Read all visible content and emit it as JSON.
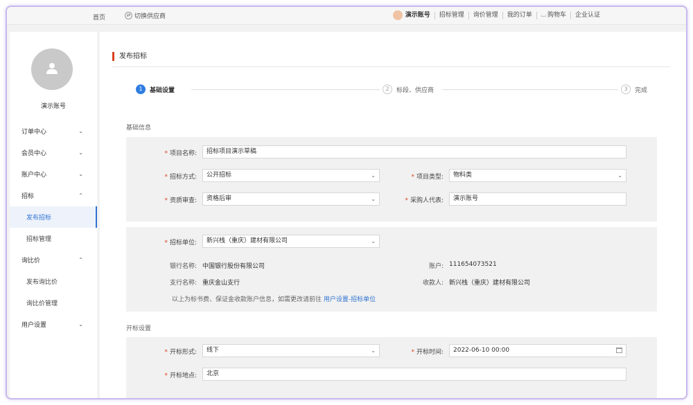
{
  "topbar": {
    "home": "首页",
    "switch_supplier": "切换供应商",
    "user": "演示账号",
    "links": [
      "招标管理",
      "询价管理",
      "我的订单",
      "购物车",
      "企业认证"
    ]
  },
  "sidebar": {
    "username": "演示账号",
    "items": [
      {
        "label": "订单中心",
        "chevron": "⌄"
      },
      {
        "label": "会员中心",
        "chevron": "⌄"
      },
      {
        "label": "账户中心",
        "chevron": "⌄"
      },
      {
        "label": "招标",
        "chevron": "⌃"
      },
      {
        "label": "发布招标"
      },
      {
        "label": "招标管理"
      },
      {
        "label": "询比价",
        "chevron": "⌃"
      },
      {
        "label": "发布询比价"
      },
      {
        "label": "询比价管理"
      },
      {
        "label": "用户设置",
        "chevron": "⌄"
      }
    ]
  },
  "main": {
    "page_title": "发布招标",
    "steps": [
      {
        "num": "1",
        "label": "基础设置"
      },
      {
        "num": "2",
        "label": "标段、供应商"
      },
      {
        "num": "3",
        "label": "完成"
      }
    ],
    "basic_title": "基础信息",
    "form": {
      "project_name_label": "项目名称:",
      "project_name_value": "招标项目演示草稿",
      "bid_method_label": "招标方式:",
      "bid_method_value": "公开招标",
      "project_type_label": "项目类型:",
      "project_type_value": "物料类",
      "qual_review_label": "资质审查:",
      "qual_review_value": "资格后审",
      "buyer_rep_label": "采购人代表:",
      "buyer_rep_value": "演示账号"
    },
    "unit": {
      "bid_unit_label": "招标单位:",
      "bid_unit_value": "新兴栈（重庆）建材有限公司",
      "bank_name_label": "银行名称:",
      "bank_name_value": "中国银行股份有限公司",
      "account_label": "账户:",
      "account_value": "111654073521",
      "branch_label": "支行名称:",
      "branch_value": "重庆金山支行",
      "payee_label": "收款人:",
      "payee_value": "新兴栈（重庆）建材有限公司",
      "note_text": "以上为标书费、保证金收款账户信息，如需更改请前往",
      "note_link": "用户设置-招标单位"
    },
    "opening_title": "开标设置",
    "opening": {
      "format_label": "开标形式:",
      "format_value": "线下",
      "time_label": "开标时间:",
      "time_value": "2022-06-10 00:00",
      "place_label": "开标地点:",
      "place_value": "北京"
    }
  },
  "icons": {
    "select_arrow": "⌄",
    "cart": "🛒",
    "switch": "⇄"
  }
}
